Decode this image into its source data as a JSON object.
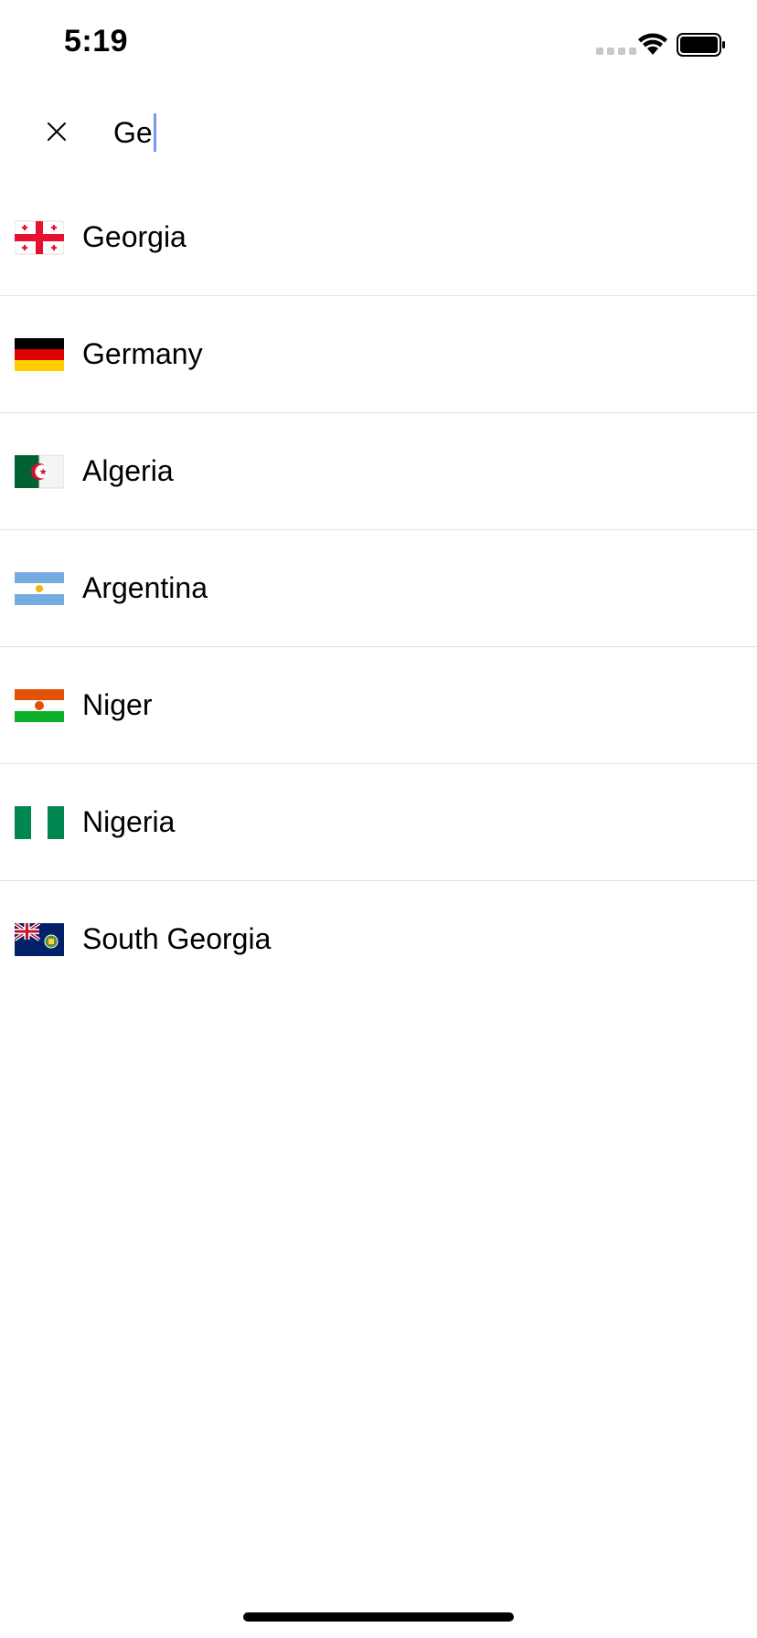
{
  "status_bar": {
    "time": "5:19",
    "wifi_icon": "wifi-icon",
    "battery_icon": "battery-full-icon",
    "signal_icon": "cellular-signal-icon"
  },
  "search": {
    "close_icon": "close-icon",
    "value": "Ge",
    "caret_color": "#7b96ee"
  },
  "countries": [
    {
      "name": "Georgia",
      "flag_icon": "georgia-flag-icon"
    },
    {
      "name": "Germany",
      "flag_icon": "germany-flag-icon"
    },
    {
      "name": "Algeria",
      "flag_icon": "algeria-flag-icon"
    },
    {
      "name": "Argentina",
      "flag_icon": "argentina-flag-icon"
    },
    {
      "name": "Niger",
      "flag_icon": "niger-flag-icon"
    },
    {
      "name": "Nigeria",
      "flag_icon": "nigeria-flag-icon"
    },
    {
      "name": "South Georgia",
      "flag_icon": "south-georgia-flag-icon"
    }
  ],
  "colors": {
    "divider": "#e1e1e1",
    "background": "#ffffff",
    "text": "#000000"
  }
}
